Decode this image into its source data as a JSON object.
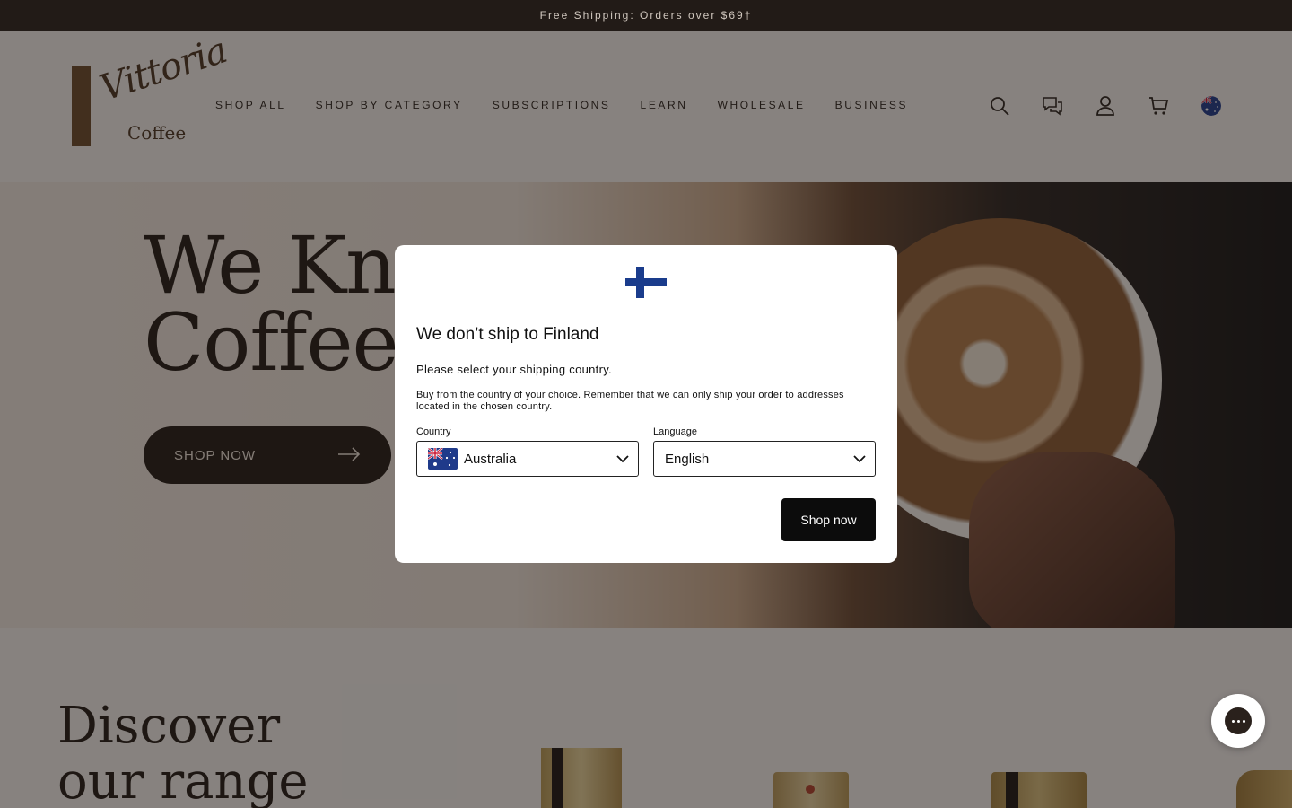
{
  "announcement": {
    "text": "Free Shipping: Orders over $69†"
  },
  "header": {
    "logo_script": "Vittoria",
    "logo_sub": "Coffee",
    "nav": [
      "SHOP ALL",
      "SHOP BY CATEGORY",
      "SUBSCRIPTIONS",
      "LEARN",
      "WHOLESALE",
      "BUSINESS"
    ],
    "icons": [
      "search-icon",
      "chat-icon",
      "account-icon",
      "cart-icon",
      "australia-flag-icon"
    ]
  },
  "hero": {
    "title_line1": "We Kno",
    "title_line2": "Coffee",
    "button_label": "SHOP NOW"
  },
  "discover": {
    "title_line1": "Discover",
    "title_line2": "our range"
  },
  "modal": {
    "flag_icon": "finland-flag-icon",
    "title": "We don’t ship to Finland",
    "subtitle": "Please select your shipping country.",
    "note": "Buy from the country of your choice. Remember that we can only ship your order to addresses located in the chosen country.",
    "country_label": "Country",
    "country_value": "Australia",
    "language_label": "Language",
    "language_value": "English",
    "button_label": "Shop now"
  },
  "chat_widget": {
    "icon": "chat-bubble-icon"
  },
  "colors": {
    "announcement_bg": "#221b17",
    "brand_dark": "#221a14",
    "logo_brown": "#6b4a2b",
    "modal_button": "#0c0c0c"
  }
}
